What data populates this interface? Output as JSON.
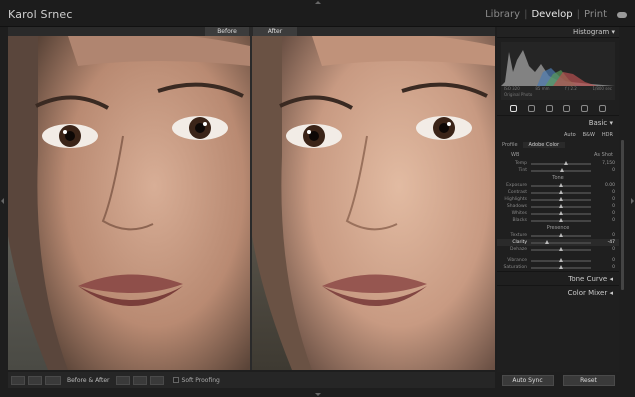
{
  "identity_plate": "Karol Srnec",
  "modules": {
    "library": "Library",
    "develop": "Develop",
    "print": "Print",
    "sep": "|"
  },
  "labels": {
    "before": "Before",
    "after": "After"
  },
  "toolbar": {
    "mode_label": "Before & After",
    "soft_proofing": "Soft Proofing"
  },
  "panel": {
    "histogram_title": "Histogram",
    "histogram_meta": {
      "iso": "ISO 320",
      "focal": "85 mm",
      "aperture": "f / 2.2",
      "shutter": "1/800 sec"
    },
    "original_photo": "Original Photo",
    "basic_title": "Basic",
    "treatment": {
      "auto": "Auto",
      "bw": "B&W",
      "hdr": "HDR"
    },
    "profile": {
      "label": "Profile",
      "value": "Adobe Color"
    },
    "wb": {
      "label": "WB",
      "value": "As Shot"
    },
    "sliders_wb": [
      {
        "name": "Temp",
        "value": "7,150",
        "pos": 0.58
      },
      {
        "name": "Tint",
        "value": "0",
        "pos": 0.52
      }
    ],
    "tone_label": "Tone",
    "sliders_tone": [
      {
        "name": "Exposure",
        "value": "0.00",
        "pos": 0.5
      },
      {
        "name": "Contrast",
        "value": "0",
        "pos": 0.5
      },
      {
        "name": "Highlights",
        "value": "0",
        "pos": 0.5
      },
      {
        "name": "Shadows",
        "value": "0",
        "pos": 0.5
      },
      {
        "name": "Whites",
        "value": "0",
        "pos": 0.5
      },
      {
        "name": "Blacks",
        "value": "0",
        "pos": 0.5
      }
    ],
    "presence_label": "Presence",
    "sliders_presence": [
      {
        "name": "Texture",
        "value": "0",
        "pos": 0.5
      },
      {
        "name": "Clarity",
        "value": "-47",
        "pos": 0.27,
        "active": true
      },
      {
        "name": "Dehaze",
        "value": "0",
        "pos": 0.5
      }
    ],
    "sliders_color": [
      {
        "name": "Vibrance",
        "value": "0",
        "pos": 0.5
      },
      {
        "name": "Saturation",
        "value": "0",
        "pos": 0.5
      }
    ],
    "tone_curve": "Tone Curve",
    "color_mixer": "Color Mixer",
    "auto_sync": "Auto Sync",
    "reset": "Reset"
  },
  "colors": {
    "accent": "#e8e8e8",
    "panel_bg": "#1f1f1f",
    "skin": "#caa08a"
  }
}
